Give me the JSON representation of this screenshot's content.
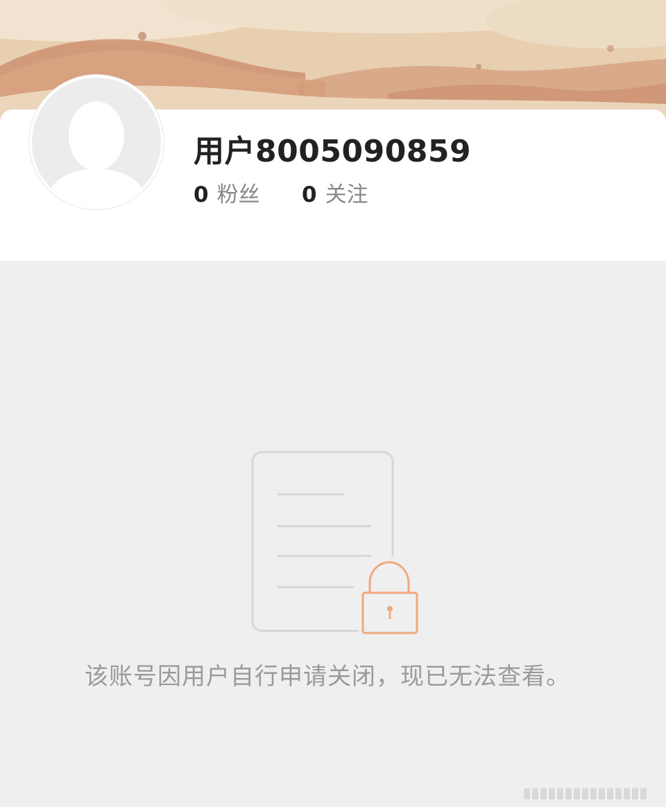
{
  "header": {
    "cover_image": "sand-beach-cover"
  },
  "profile": {
    "avatar_icon": "default-avatar-silhouette-icon",
    "username": "用户8005090859",
    "followers_count": "0",
    "followers_label": "粉丝",
    "following_count": "0",
    "following_label": "关注"
  },
  "content": {
    "empty_state_icon": "locked-document-icon",
    "message": "该账号因用户自行申请关闭，现已无法查看。"
  },
  "colors": {
    "background": "#efefef",
    "card": "#ffffff",
    "accent_lock": "#f0a87c",
    "icon_gray": "#d6d6d6",
    "text_primary": "#222222",
    "text_secondary": "#888888",
    "text_message": "#9a9a9a"
  }
}
